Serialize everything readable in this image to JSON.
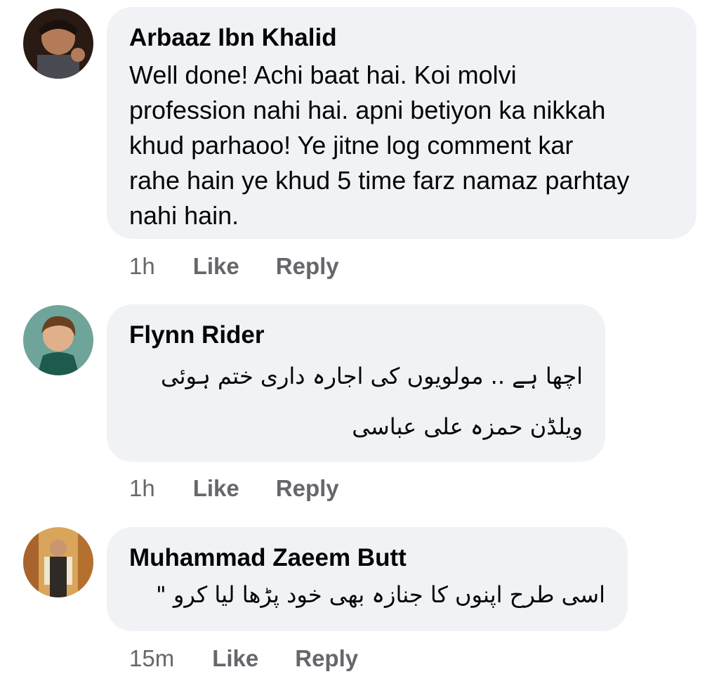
{
  "comments": [
    {
      "author": "Arbaaz Ibn Khalid",
      "lines": [
        "Well done! Achi baat hai. Koi molvi",
        "profession nahi hai. apni betiyon ka nikkah",
        "khud parhaoo! Ye jitne log comment kar",
        "rahe hain ye khud 5 time farz namaz parhtay",
        "nahi hain."
      ],
      "time": "1h",
      "like_label": "Like",
      "reply_label": "Reply"
    },
    {
      "author": "Flynn Rider",
      "lines": [
        "اچھا ہے .. مولویوں کی اجارہ داری ختم ہوئی",
        "ویلڈن حمزہ علی عباسی"
      ],
      "time": "1h",
      "like_label": "Like",
      "reply_label": "Reply"
    },
    {
      "author": "Muhammad Zaeem Butt",
      "lines": [
        "اسی طرح اپنوں کا جنازہ بھی خود پڑھا لیا کرو \""
      ],
      "time": "15m",
      "like_label": "Like",
      "reply_label": "Reply"
    }
  ]
}
